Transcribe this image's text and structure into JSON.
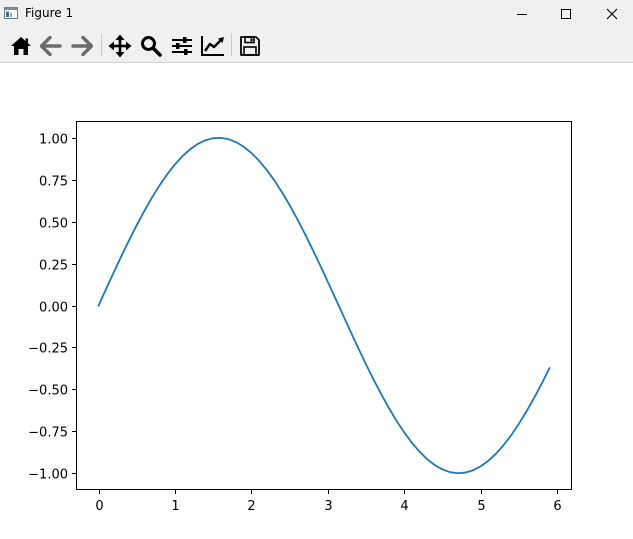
{
  "window": {
    "title": "Figure 1",
    "controls": {
      "minimize": "minimize-icon",
      "maximize": "maximize-icon",
      "close": "close-icon"
    }
  },
  "toolbar": {
    "tools": [
      {
        "name": "home",
        "icon": "home-icon"
      },
      {
        "name": "back",
        "icon": "arrow-left-icon"
      },
      {
        "name": "forward",
        "icon": "arrow-right-icon"
      },
      {
        "name": "pan",
        "icon": "move-icon"
      },
      {
        "name": "zoom",
        "icon": "magnifier-icon"
      },
      {
        "name": "configure-subplots",
        "icon": "sliders-icon"
      },
      {
        "name": "edit-axes",
        "icon": "trend-line-icon"
      },
      {
        "name": "save",
        "icon": "floppy-disk-icon"
      }
    ]
  },
  "chart_data": {
    "type": "line",
    "function": "sin(x)",
    "x_start": 0,
    "x_end": 5.9,
    "x_step": 0.1,
    "series": [
      {
        "color": "#1f77b4",
        "x": [
          0,
          0.5,
          1,
          1.5,
          2,
          2.5,
          3,
          3.5,
          4,
          4.5,
          5,
          5.5,
          5.9
        ],
        "y": [
          0,
          0.479,
          0.841,
          0.997,
          0.909,
          0.598,
          0.141,
          -0.351,
          -0.757,
          -0.978,
          -0.959,
          -0.706,
          -0.374
        ]
      }
    ],
    "xlim": [
      -0.295,
      6.195
    ],
    "ylim": [
      -1.1,
      1.1
    ],
    "xticks": [
      "0",
      "1",
      "2",
      "3",
      "4",
      "5",
      "6"
    ],
    "yticks": [
      "1.00",
      "0.75",
      "0.50",
      "0.25",
      "0.00",
      "−0.25",
      "−0.50",
      "−0.75",
      "−1.00"
    ],
    "title": "",
    "xlabel": "",
    "ylabel": "",
    "grid": false,
    "legend": false
  }
}
